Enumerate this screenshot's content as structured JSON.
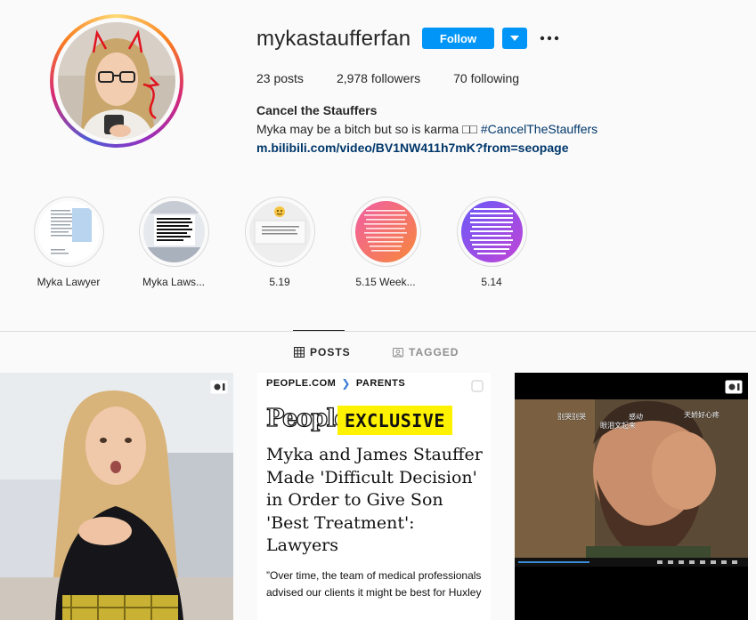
{
  "profile": {
    "username": "mykastaufferfan",
    "follow_label": "Follow",
    "posts_count": "23",
    "posts_label": "posts",
    "followers_count": "2,978",
    "followers_label": "followers",
    "following_count": "70",
    "following_label": "following",
    "bio_name": "Cancel the Stauffers",
    "bio_text": "Myka may be a bitch but so is karma □□ ",
    "bio_hashtag": "#CancelTheStauffers",
    "bio_link": "m.bilibili.com/video/BV1NW411h7mK?from=seopage"
  },
  "highlights": [
    {
      "label": "Myka Lawyer"
    },
    {
      "label": "Myka Laws..."
    },
    {
      "label": "5.19"
    },
    {
      "label": "5.15 Week..."
    },
    {
      "label": "5.14"
    }
  ],
  "tabs": {
    "posts": "POSTS",
    "tagged": "TAGGED"
  },
  "posts": {
    "post2": {
      "breadcrumb_site": "PEOPLE.COM",
      "breadcrumb_section": "PARENTS",
      "logo": "People",
      "badge": "EXCLUSIVE",
      "headline": "Myka and James Stauffer Made 'Difficult Decision' in Order to Give Son 'Best Treatment': Lawyers",
      "quote": "”Over time, the team of medical professionals advised our clients it might be best for Huxley"
    },
    "post3": {
      "subtitles": [
        "别哭别哭",
        "感动",
        "天娇好心疼",
        "眼泪文起来"
      ]
    }
  },
  "colors": {
    "accent": "#0095f6",
    "link": "#00376b",
    "border": "#dbdbdb",
    "muted": "#8e8e8e"
  },
  "icons": {
    "more": "three-dots-icon",
    "dropdown": "caret-down-icon",
    "posts_tab": "grid-icon",
    "tagged_tab": "tag-icon",
    "video": "video-icon",
    "multi": "multiple-posts-icon"
  }
}
